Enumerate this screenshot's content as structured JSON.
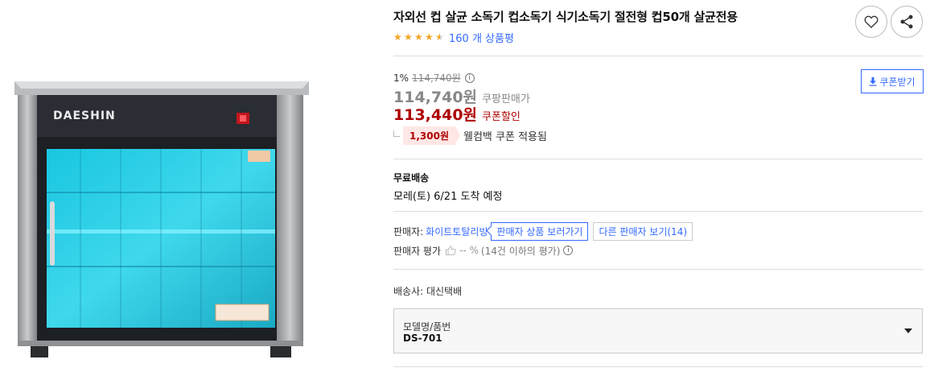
{
  "product": {
    "title": "자외선 컵 살균 소독기 컵소독기 식기소독기 절전형 컵50개 살균전용",
    "brand_text": "DAESHIN",
    "rating_stars": 4.5,
    "review_text": "160 개 상품평"
  },
  "actions": {
    "wish_icon": "heart-icon",
    "share_icon": "share-icon",
    "coupon_download": "쿠폰받기"
  },
  "price": {
    "discount_rate": "1%",
    "origin_price": "114,740원",
    "info_mark": "i",
    "sale_price": "114,740원",
    "sale_label": "쿠팡판매가",
    "coupon_price": "113,440원",
    "coupon_label": "쿠폰할인",
    "welcome_amount": "1,300원",
    "welcome_text": "웰컴백 쿠폰 적용됨"
  },
  "shipping": {
    "title": "무료배송",
    "date": "모레(토) 6/21 도착 예정"
  },
  "seller": {
    "label": "판매자:",
    "name": "화이트토탈리빙",
    "products_button": "판매자 상품 보러가기",
    "other_sellers": "다른 판매자 보기",
    "other_count": "(14)",
    "rating_label": "판매자 평가",
    "rating_value": "-- %",
    "rating_note": "(14건 이하의 평가)"
  },
  "carrier": {
    "text": "배송사:  대신택배"
  },
  "option": {
    "label": "모델명/품번",
    "value": "DS-701"
  },
  "colors": {
    "link": "#346aff",
    "coupon_red": "#ae0000",
    "star": "#f5a623"
  }
}
